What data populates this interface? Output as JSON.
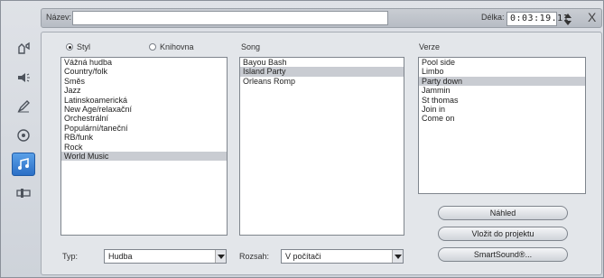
{
  "header": {
    "name_label": "Název:",
    "name_value": "",
    "duration_label": "Délka:",
    "duration_value": "0:03:19.11",
    "close_glyph": "X"
  },
  "sidebar": {
    "icons": [
      "video-icon",
      "sound-icon",
      "pen-icon",
      "disc-icon",
      "music-icon",
      "slider-icon"
    ],
    "active": "music-icon"
  },
  "source": {
    "style_label": "Styl",
    "library_label": "Knihovna",
    "selected": "Styl"
  },
  "lists": {
    "style_items": [
      "Vážná hudba",
      "Country/folk",
      "Směs",
      "Jazz",
      "Latinskoamerická",
      "New Age/relaxační",
      "Orchestrální",
      "Populární/taneční",
      "RB/funk",
      "Rock",
      "World Music"
    ],
    "style_selected": "World Music",
    "song_heading": "Song",
    "song_items": [
      "Bayou Bash",
      "Island Party",
      "Orleans Romp"
    ],
    "song_selected": "Island Party",
    "version_heading": "Verze",
    "version_items": [
      "Pool side",
      "Limbo",
      "Party down",
      "Jammin",
      "St thomas",
      "Join in",
      "Come on"
    ],
    "version_selected": "Party down"
  },
  "filters": {
    "type_label": "Typ:",
    "type_value": "Hudba",
    "range_label": "Rozsah:",
    "range_value": "V počítači"
  },
  "buttons": {
    "preview": "Náhled",
    "insert": "Vložit do projektu",
    "smartsound": "SmartSound®..."
  }
}
